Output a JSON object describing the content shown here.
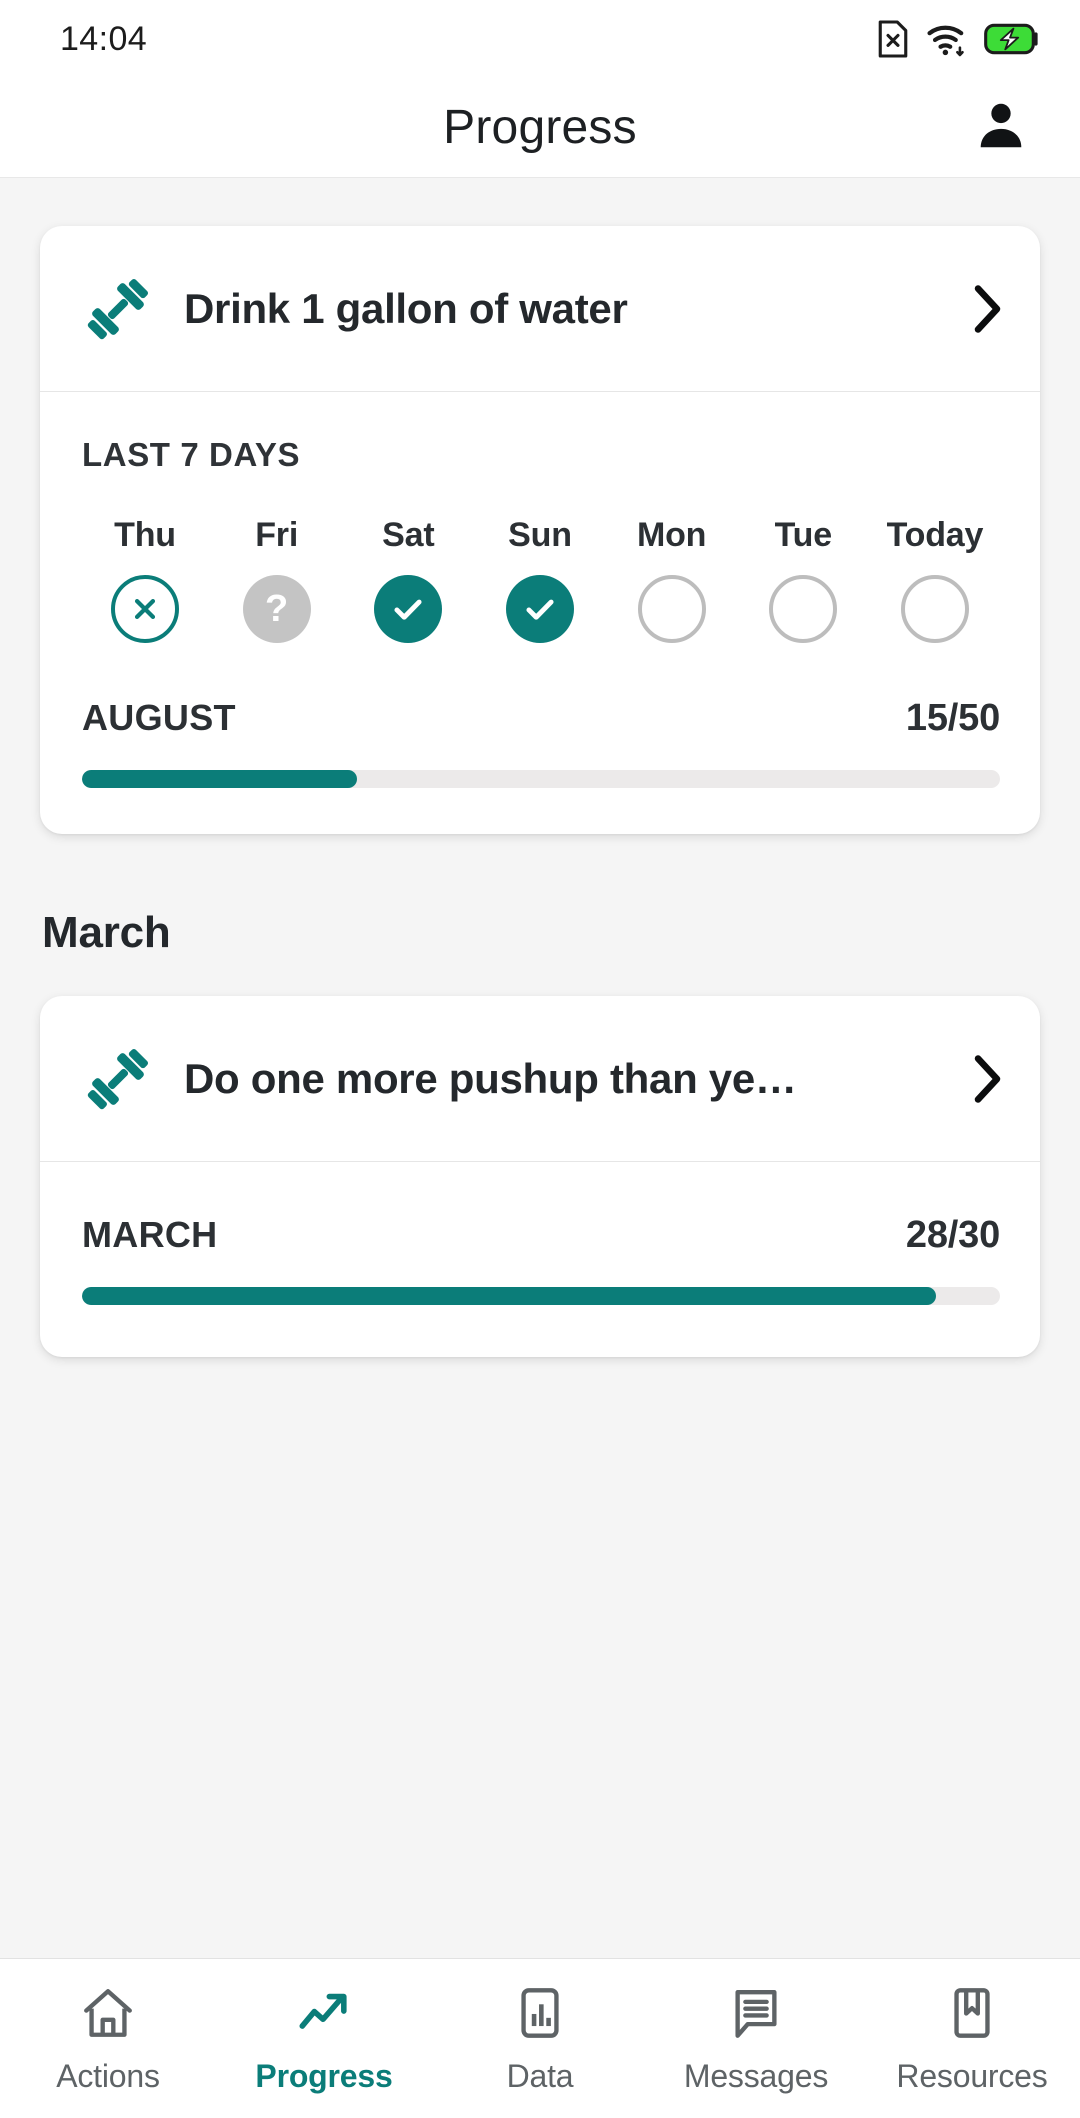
{
  "status_bar": {
    "time": "14:04",
    "icons": [
      "sim-card-missing-icon",
      "wifi-icon",
      "battery-charging-icon"
    ],
    "battery_color": "#3ddc37"
  },
  "app_bar": {
    "title": "Progress",
    "account_icon": "person-icon"
  },
  "theme": {
    "accent": "#0b7d79",
    "background": "#f5f5f5",
    "card": "#ffffff",
    "muted": "#c4c4c4",
    "track": "#eceaea"
  },
  "goals": [
    {
      "group_title": "",
      "icon": "dumbbell-icon",
      "title": "Drink 1 gallon of water",
      "chevron": "chevron-right-icon",
      "week_label": "LAST 7 DAYS",
      "days": [
        {
          "name": "Thu",
          "state": "missed",
          "glyph": "x-icon"
        },
        {
          "name": "Fri",
          "state": "unknown",
          "glyph": "?"
        },
        {
          "name": "Sat",
          "state": "done",
          "glyph": "check-icon"
        },
        {
          "name": "Sun",
          "state": "done",
          "glyph": "check-icon"
        },
        {
          "name": "Mon",
          "state": "empty",
          "glyph": ""
        },
        {
          "name": "Tue",
          "state": "empty",
          "glyph": ""
        },
        {
          "name": "Today",
          "state": "empty",
          "glyph": ""
        }
      ],
      "month_label": "AUGUST",
      "month_count": "15/50",
      "progress_percent": 30
    },
    {
      "group_title": "March",
      "icon": "dumbbell-icon",
      "title": "Do one more pushup than ye…",
      "chevron": "chevron-right-icon",
      "week_label": "",
      "days": [],
      "month_label": "MARCH",
      "month_count": "28/30",
      "progress_percent": 93
    }
  ],
  "bottom_nav": {
    "items": [
      {
        "label": "Actions",
        "icon": "home-icon",
        "active": false
      },
      {
        "label": "Progress",
        "icon": "trending-up-icon",
        "active": true
      },
      {
        "label": "Data",
        "icon": "bar-chart-icon",
        "active": false
      },
      {
        "label": "Messages",
        "icon": "chat-icon",
        "active": false
      },
      {
        "label": "Resources",
        "icon": "bookmark-icon",
        "active": false
      }
    ]
  }
}
